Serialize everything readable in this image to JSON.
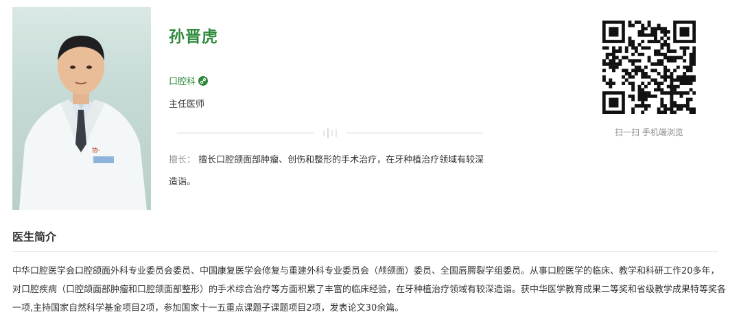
{
  "doctor": {
    "name": "孙晋虎",
    "department": "口腔科",
    "title": "主任医师",
    "specialty_label": "擅长：",
    "specialty_text": "擅长口腔颌面部肿瘤、创伤和整形的手术治疗，在牙种植治疗领域有较深造诣。"
  },
  "qr": {
    "caption": "扫一扫 手机端浏览"
  },
  "intro": {
    "heading": "医生简介",
    "text": "中华口腔医学会口腔颌面外科专业委员会委员、中国康复医学会修复与重建外科专业委员会（颅颌面）委员、全国唇腭裂学组委员。从事口腔医学的临床、教学和科研工作20多年，对口腔疾病（口腔颌面部肿瘤和口腔颌面部整形）的手术综合治疗等方面积累了丰富的临床经验，在牙种植治疗领域有较深造诣。获中华医学教育成果二等奖和省级教学成果特等奖各一项,主持国家自然科学基金项目2项，参加国家十一五重点课题子课题项目2项，发表论文30余篇。"
  },
  "colors": {
    "accent": "#2f8a3c",
    "muted": "#999999"
  },
  "icons": {
    "department": "link-icon",
    "photo": "doctor-portrait",
    "qr": "qr-code-icon"
  }
}
